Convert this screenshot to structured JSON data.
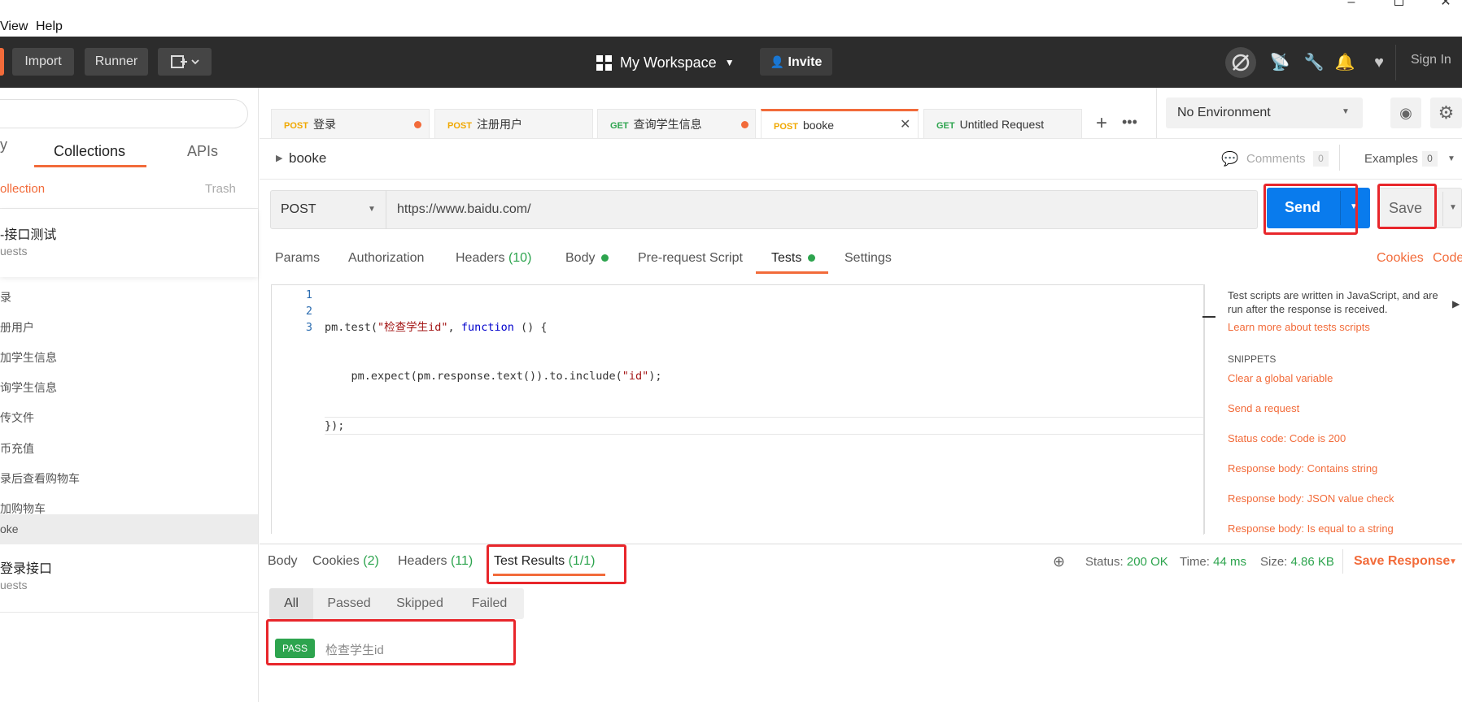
{
  "menubar": {
    "items": [
      "View",
      "Help"
    ]
  },
  "header": {
    "buttons": {
      "import": "Import",
      "runner": "Runner"
    },
    "workspace": "My Workspace",
    "invite": "Invite",
    "signin": "Sign In"
  },
  "sidebar": {
    "tabs": {
      "collections": "Collections",
      "apis": "APIs"
    },
    "new_collection": "ollection",
    "trash": "Trash",
    "collections": [
      {
        "name": "-接口测试",
        "meta": "uests"
      },
      {
        "name": "登录接口",
        "meta": "uests"
      }
    ],
    "requests": [
      "录",
      "册用户",
      "加学生信息",
      "询学生信息",
      "传文件",
      "币充值",
      "录后查看购物车",
      "加购物车",
      "oke"
    ]
  },
  "tabs": [
    {
      "method": "POST",
      "name": "登录"
    },
    {
      "method": "POST",
      "name": "注册用户"
    },
    {
      "method": "GET",
      "name": "查询学生信息"
    },
    {
      "method": "POST",
      "name": "booke"
    },
    {
      "method": "GET",
      "name": "Untitled Request"
    }
  ],
  "environment": {
    "selected": "No Environment"
  },
  "request": {
    "name": "booke",
    "comments_label": "Comments",
    "comments_count": "0",
    "examples_label": "Examples",
    "examples_count": "0",
    "method": "POST",
    "url": "https://www.baidu.com/",
    "send": "Send",
    "save": "Save"
  },
  "request_tabs": {
    "params": "Params",
    "authorization": "Authorization",
    "headers": "Headers",
    "headers_count": "(10)",
    "body": "Body",
    "prerequest": "Pre-request Script",
    "tests": "Tests",
    "settings": "Settings",
    "cookies": "Cookies",
    "code": "Code"
  },
  "editor": {
    "line_numbers": [
      "1",
      "2",
      "3"
    ],
    "line1": {
      "a": "pm.test(",
      "str": "\"检查学生id\"",
      "b": ", ",
      "kw": "function",
      "c": " () {"
    },
    "line2": {
      "a": "    pm.expect(pm.response.text()).to.include(",
      "str": "\"id\"",
      "b": ");"
    },
    "line3": "});"
  },
  "snippets_panel": {
    "desc": "Test scripts are written in JavaScript, and are run after the response is received.",
    "learn": "Learn more about tests scripts",
    "heading": "SNIPPETS",
    "items": [
      "Clear a global variable",
      "Send a request",
      "Status code: Code is 200",
      "Response body: Contains string",
      "Response body: JSON value check",
      "Response body: Is equal to a string"
    ]
  },
  "response": {
    "tabs": {
      "body": "Body",
      "cookies": "Cookies",
      "cookies_count": "(2)",
      "headers": "Headers",
      "headers_count": "(11)",
      "tests": "Test Results",
      "tests_count": "(1/1)"
    },
    "status_label": "Status:",
    "status": "200 OK",
    "time_label": "Time:",
    "time": "44 ms",
    "size_label": "Size:",
    "size": "4.86 KB",
    "save_response": "Save Response",
    "filters": [
      "All",
      "Passed",
      "Skipped",
      "Failed"
    ],
    "result": {
      "badge": "PASS",
      "name": "检查学生id"
    }
  },
  "colors": {
    "accent": "#f26b3a",
    "send": "#097bed",
    "pass": "#2da44e",
    "annotation": "#e8262b"
  }
}
